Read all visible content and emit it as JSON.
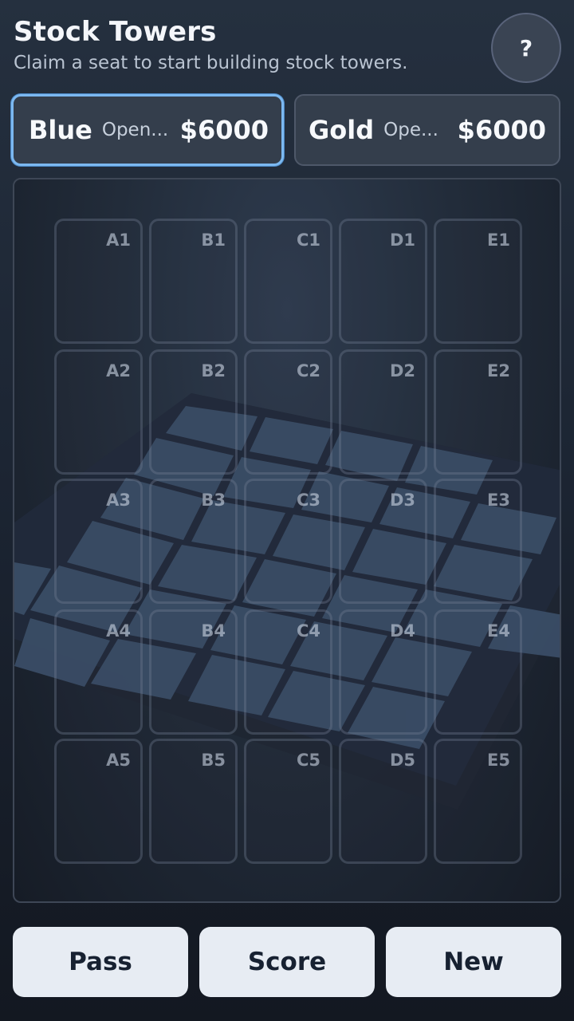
{
  "header": {
    "title": "Stock Towers",
    "subtitle": "Claim a seat to start building stock towers.",
    "help_label": "?"
  },
  "seats": [
    {
      "name": "Blue",
      "status": "Open...",
      "money": "$6000",
      "selected": true,
      "accent": "#7cb8f0"
    },
    {
      "name": "Gold",
      "status": "Ope...",
      "money": "$6000",
      "selected": false
    }
  ],
  "board": {
    "columns": [
      "A",
      "B",
      "C",
      "D",
      "E"
    ],
    "rows": [
      "1",
      "2",
      "3",
      "4",
      "5"
    ],
    "cells": [
      [
        "A1",
        "B1",
        "C1",
        "D1",
        "E1"
      ],
      [
        "A2",
        "B2",
        "C2",
        "D2",
        "E2"
      ],
      [
        "A3",
        "B3",
        "C3",
        "D3",
        "E3"
      ],
      [
        "A4",
        "B4",
        "C4",
        "D4",
        "E4"
      ],
      [
        "A5",
        "B5",
        "C5",
        "D5",
        "E5"
      ]
    ]
  },
  "actions": {
    "pass_label": "Pass",
    "score_label": "Score",
    "new_label": "New"
  }
}
